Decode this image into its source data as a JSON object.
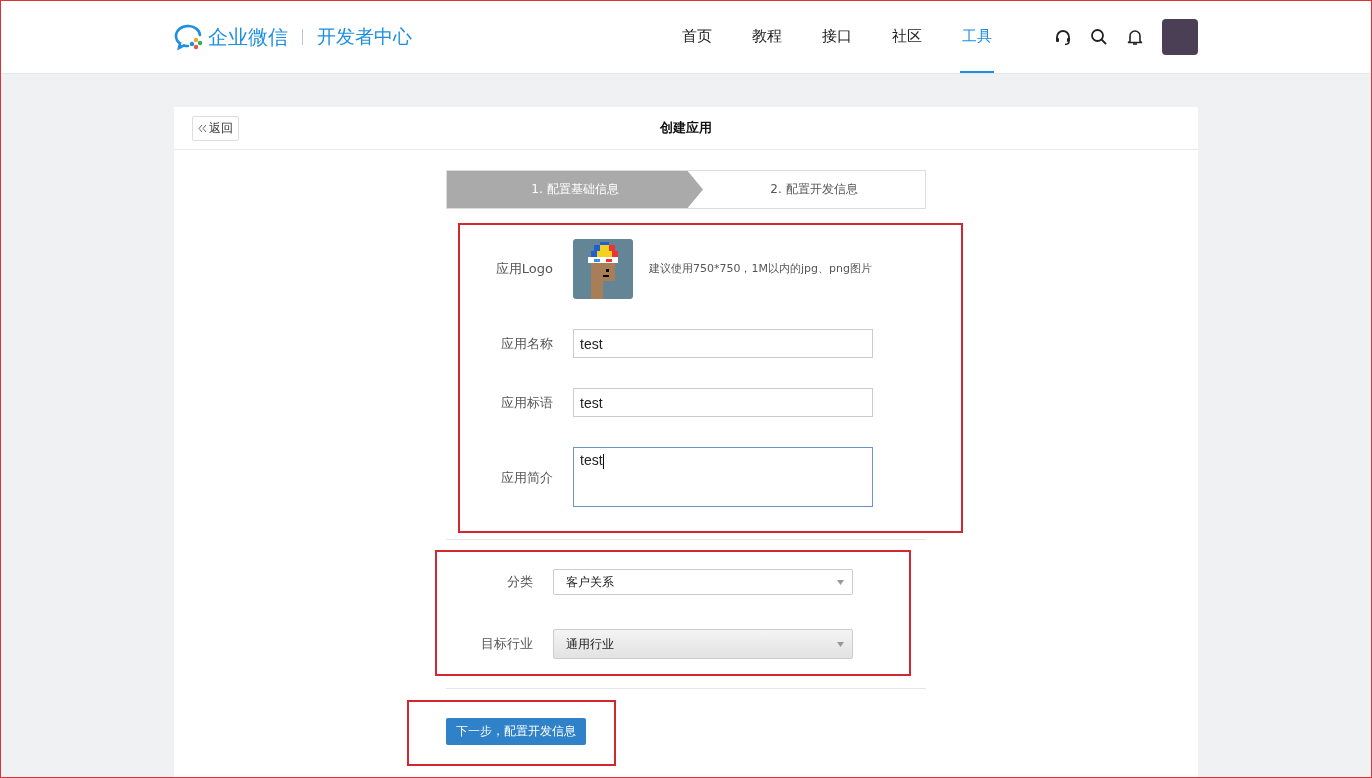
{
  "header": {
    "brand": "企业微信",
    "subtitle": "开发者中心",
    "nav": [
      {
        "label": "首页",
        "selected": false
      },
      {
        "label": "教程",
        "selected": false
      },
      {
        "label": "接口",
        "selected": false
      },
      {
        "label": "社区",
        "selected": false
      },
      {
        "label": "工具",
        "selected": true
      }
    ]
  },
  "page": {
    "back": "返回",
    "title": "创建应用",
    "steps": [
      {
        "label": "1. 配置基础信息",
        "selected": true
      },
      {
        "label": "2. 配置开发信息",
        "selected": false
      }
    ],
    "basic": {
      "highlighted": true,
      "logo_label": "应用Logo",
      "logo_hint": "建议使用750*750，1M以内的jpg、png图片",
      "fields": [
        {
          "kind": "input",
          "label": "应用名称",
          "value": "test",
          "focused": false
        },
        {
          "kind": "input",
          "label": "应用标语",
          "value": "test",
          "focused": false
        },
        {
          "kind": "textarea",
          "label": "应用简介",
          "value": "test",
          "focused": true
        }
      ]
    },
    "category": {
      "highlighted": true,
      "selects": [
        {
          "label": "分类",
          "value": "客户关系",
          "disabled": false
        },
        {
          "label": "目标行业",
          "value": "通用行业",
          "disabled": true
        }
      ]
    },
    "submit": {
      "highlighted": true,
      "label": "下一步，配置开发信息"
    }
  }
}
